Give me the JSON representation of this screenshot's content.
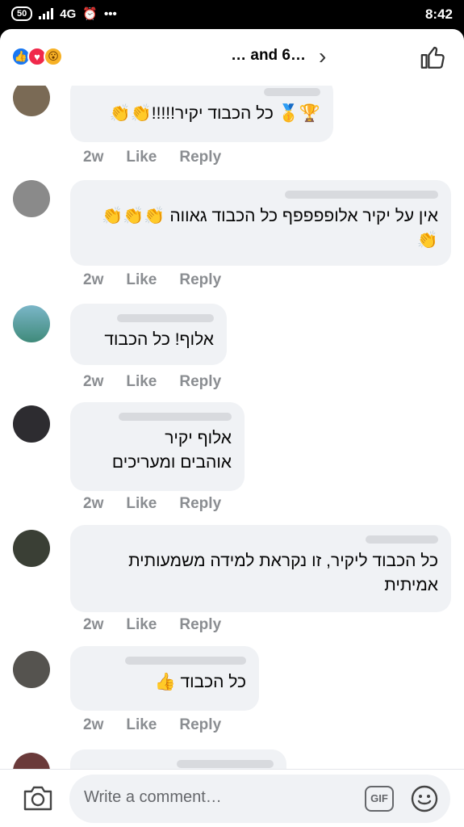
{
  "statusbar": {
    "battery": "50",
    "network": "4G",
    "time": "8:42"
  },
  "header": {
    "reactors": "… and 6…",
    "reaction_icons": [
      "like-icon",
      "love-icon",
      "wow-icon"
    ]
  },
  "comments": [
    {
      "text": "🏆🥇 כל הכבוד יקיר!!!!!👏👏",
      "time": "2w",
      "like": "Like",
      "reply": "Reply"
    },
    {
      "text": "אין על יקיר אלופפפפף כל הכבוד גאווה 👏👏👏👏",
      "time": "2w",
      "like": "Like",
      "reply": "Reply"
    },
    {
      "text": "אלוף! כל הכבוד",
      "time": "2w",
      "like": "Like",
      "reply": "Reply"
    },
    {
      "text": "אלוף יקיר",
      "text2": "אוהבים ומעריכים",
      "time": "2w",
      "like": "Like",
      "reply": "Reply"
    },
    {
      "text": "כל הכבוד ליקיר, זו נקראת למידה משמעותית אמיתית",
      "time": "2w",
      "like": "Like",
      "reply": "Reply"
    },
    {
      "text": "כל הכבוד 👍",
      "time": "2w",
      "like": "Like",
      "reply": "Reply"
    }
  ],
  "composer": {
    "placeholder": "Write a comment…",
    "gif_label": "GIF"
  },
  "colors": {
    "bubble": "#f0f2f5",
    "meta": "#8a8d91",
    "like_blue": "#1877f2"
  }
}
